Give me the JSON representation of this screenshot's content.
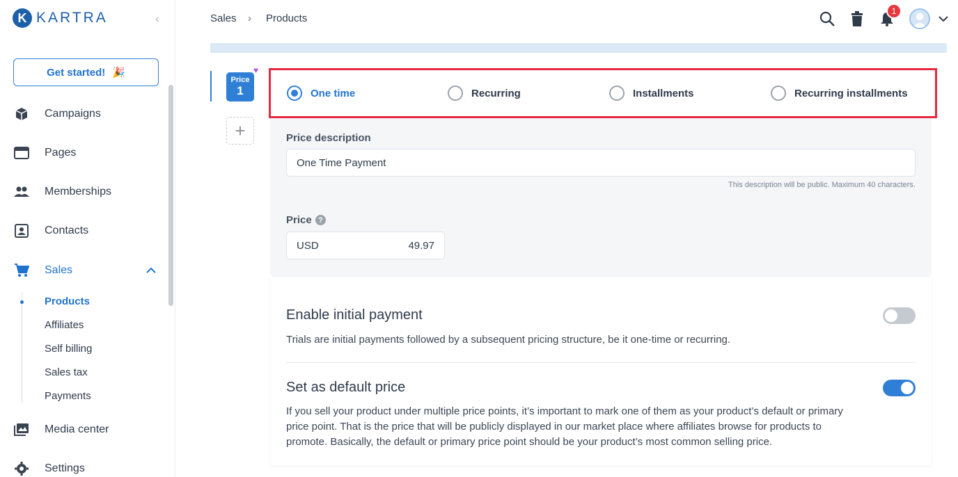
{
  "sidebar": {
    "logo": "KARTRA",
    "get_started": "Get started!",
    "items": [
      {
        "label": "Campaigns",
        "icon": "box-icon"
      },
      {
        "label": "Pages",
        "icon": "browser-icon"
      },
      {
        "label": "Memberships",
        "icon": "people-icon"
      },
      {
        "label": "Contacts",
        "icon": "contact-card-icon"
      },
      {
        "label": "Sales",
        "icon": "cart-icon"
      },
      {
        "label": "Media center",
        "icon": "images-icon"
      },
      {
        "label": "Settings",
        "icon": "gear-icon"
      }
    ],
    "sales_sub": [
      "Products",
      "Affiliates",
      "Self billing",
      "Sales tax",
      "Payments"
    ]
  },
  "header": {
    "breadcrumb": [
      "Sales",
      "Products"
    ],
    "notifications": "1"
  },
  "price_tab": {
    "label": "Price",
    "number": "1"
  },
  "pricing_types": [
    "One time",
    "Recurring",
    "Installments",
    "Recurring installments"
  ],
  "selected_type": "One time",
  "form": {
    "description_label": "Price description",
    "description_value": "One Time Payment",
    "description_hint": "This description will be public. Maximum 40 characters.",
    "price_label": "Price",
    "currency": "USD",
    "amount": "49.97"
  },
  "initial_payment": {
    "title": "Enable initial payment",
    "text": "Trials are initial payments followed by a subsequent pricing structure, be it one-time or recurring.",
    "enabled": false
  },
  "default_price": {
    "title": "Set as default price",
    "text": "If you sell your product under multiple price points, it’s important to mark one of them as your product’s default or primary price point. That is the price that will be publicly displayed in our market place where affiliates browse for products to promote. Basically, the default or primary price point should be your product’s most common selling price.",
    "enabled": true
  },
  "colors": {
    "accent": "#2f7fd6",
    "highlight": "#e8273e",
    "badge": "#e8373d"
  }
}
